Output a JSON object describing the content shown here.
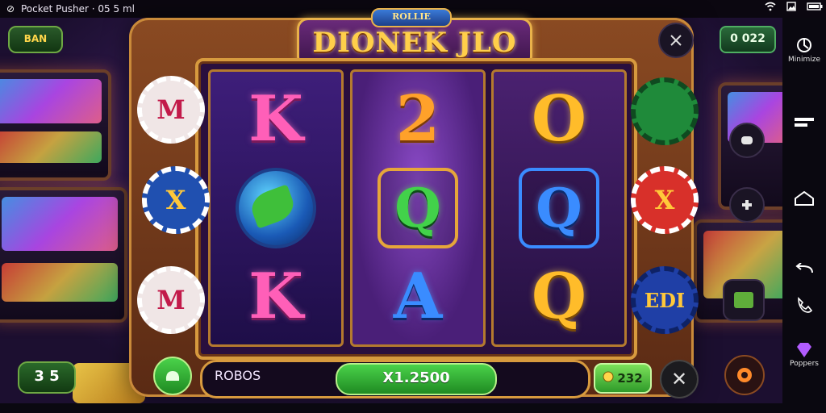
{
  "status_bar": {
    "title": "Pocket Pusher · 05 5 ml",
    "icons": [
      "back-icon",
      "wifi-icon",
      "image-icon",
      "battery-icon"
    ]
  },
  "game": {
    "title": "DIONEK JLO",
    "badge": "ROLLIE",
    "top_left_badge": "BAN",
    "top_right_counter": "0 022",
    "left_bottom_value": "3 5",
    "bet_label": "ROBOS",
    "win_display": "X1.2500",
    "credit_value": "232",
    "close_label": "✕",
    "side_chip_labels": [
      "M",
      "X",
      "M",
      "",
      "X",
      "EDI"
    ],
    "reels": [
      [
        "K",
        "",
        "K"
      ],
      [
        "2",
        "Q",
        "A"
      ],
      [
        "O",
        "Q",
        "Q"
      ]
    ]
  },
  "nav_rail": {
    "top_label": "Minimize",
    "bottom_label": "Poppers",
    "icons": [
      "minimize-icon",
      "recents-icon",
      "home-icon",
      "back-icon",
      "phone-icon",
      "gem-icon"
    ]
  }
}
